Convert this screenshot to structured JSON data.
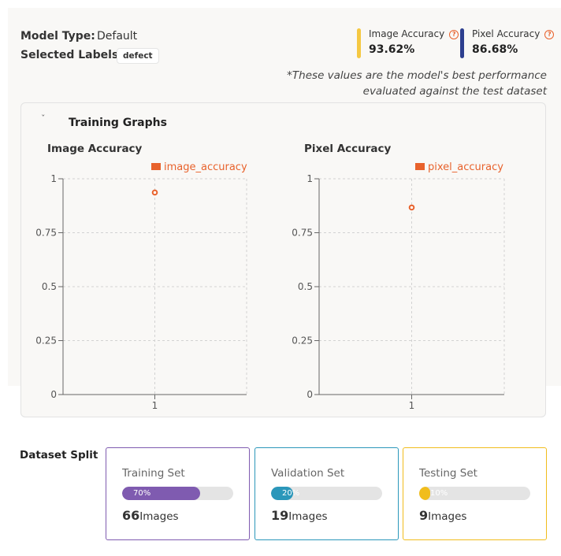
{
  "model": {
    "type_label": "Model Type:",
    "type_value": "Default",
    "labels_label": "Selected Labels:",
    "labels": [
      "defect"
    ]
  },
  "metrics": [
    {
      "label": "Image Accuracy",
      "value": "93.62%",
      "color": "#f5c842",
      "help_icon": "question-circle-icon"
    },
    {
      "label": "Pixel Accuracy",
      "value": "86.68%",
      "color": "#2d3f8f",
      "help_icon": "question-circle-icon"
    }
  ],
  "note": {
    "line1": "*These values are the model's best performance",
    "line2": "evaluated against the test dataset"
  },
  "training_graphs": {
    "title": "Training Graphs",
    "toggle_icon": "chevron-down-icon"
  },
  "chart_data": [
    {
      "type": "scatter",
      "title": "Image Accuracy",
      "series": [
        {
          "name": "image_accuracy",
          "x": [
            1
          ],
          "y": [
            0.9362
          ],
          "color": "#e8622c"
        }
      ],
      "xticks": [
        "1"
      ],
      "yticks": [
        "0",
        "0.25",
        "0.5",
        "0.75",
        "1"
      ],
      "ylim": [
        0,
        1
      ],
      "grid": true,
      "legend": "top"
    },
    {
      "type": "scatter",
      "title": "Pixel Accuracy",
      "series": [
        {
          "name": "pixel_accuracy",
          "x": [
            1
          ],
          "y": [
            0.8668
          ],
          "color": "#e8622c"
        }
      ],
      "xticks": [
        "1"
      ],
      "yticks": [
        "0",
        "0.25",
        "0.5",
        "0.75",
        "1"
      ],
      "ylim": [
        0,
        1
      ],
      "grid": true,
      "legend": "top"
    }
  ],
  "dataset_split": {
    "title": "Dataset Split",
    "unit": "Images",
    "sets": [
      {
        "name": "Training Set",
        "percent": "70%",
        "fraction": 0.7,
        "count": "66",
        "color": "#7f5bb0"
      },
      {
        "name": "Validation Set",
        "percent": "20%",
        "fraction": 0.2,
        "count": "19",
        "color": "#2b97ba"
      },
      {
        "name": "Testing Set",
        "percent": "10%",
        "fraction": 0.1,
        "count": "9",
        "color": "#f1bd1c"
      }
    ]
  }
}
